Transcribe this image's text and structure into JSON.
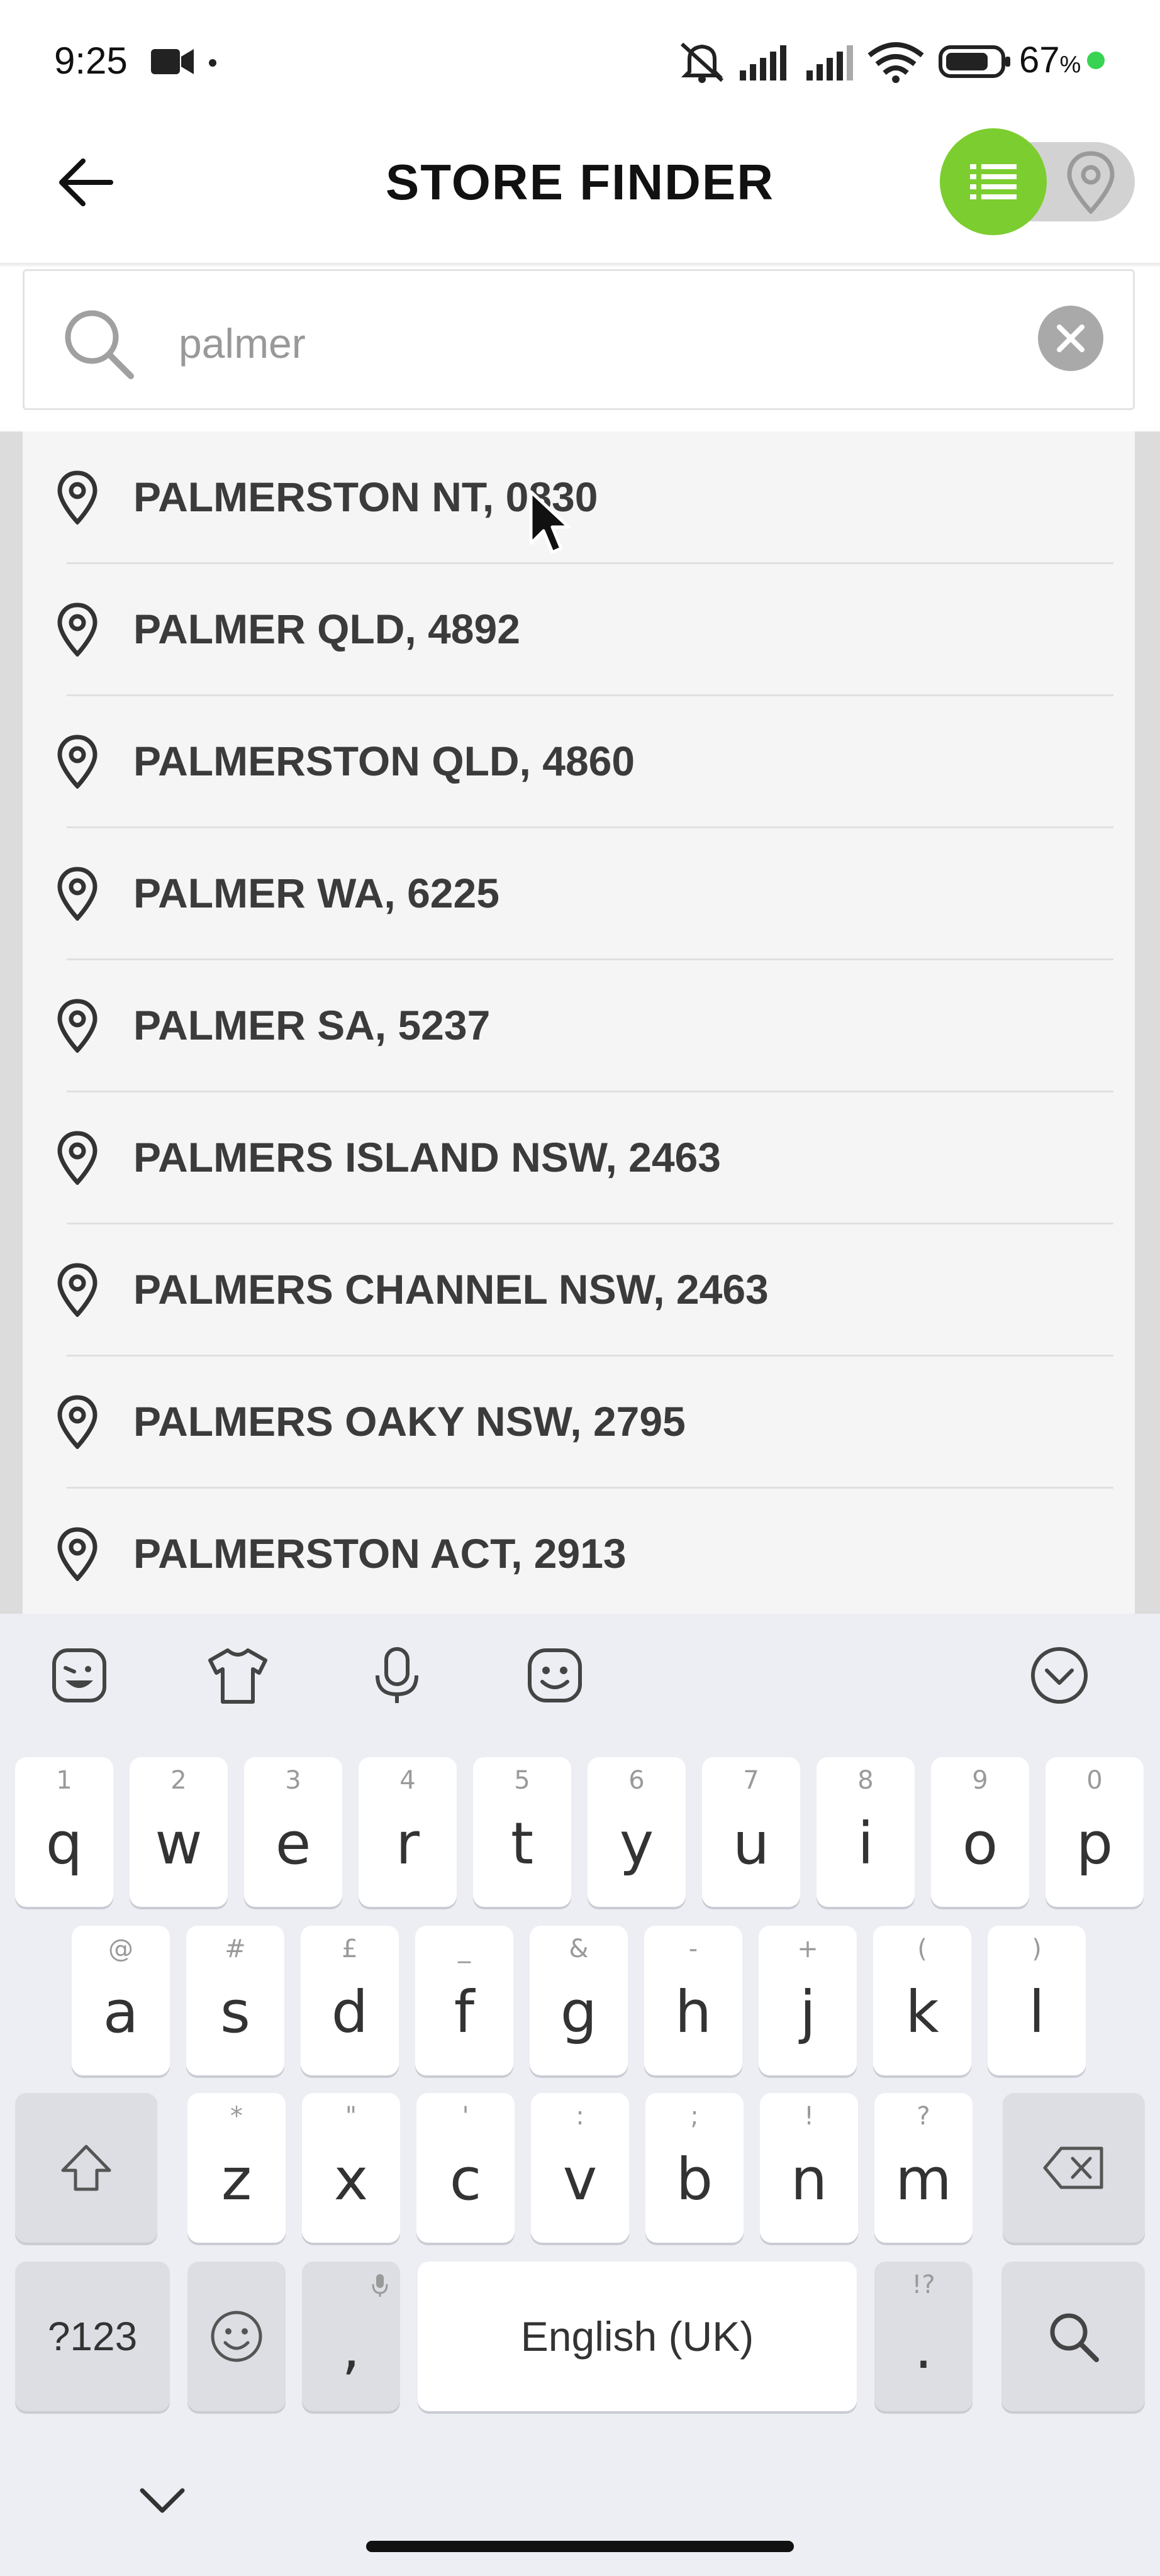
{
  "status_bar": {
    "time": "9:25",
    "battery": "67",
    "battery_unit": "%"
  },
  "header": {
    "title": "STORE FINDER"
  },
  "search": {
    "query": "palmer",
    "placeholder": ""
  },
  "results": [
    {
      "label": "PALMERSTON NT, 0830"
    },
    {
      "label": "PALMER QLD, 4892"
    },
    {
      "label": "PALMERSTON QLD, 4860"
    },
    {
      "label": "PALMER WA, 6225"
    },
    {
      "label": "PALMER SA, 5237"
    },
    {
      "label": "PALMERS ISLAND NSW, 2463"
    },
    {
      "label": "PALMERS CHANNEL NSW, 2463"
    },
    {
      "label": "PALMERS OAKY NSW, 2795"
    },
    {
      "label": "PALMERSTON ACT, 2913"
    }
  ],
  "keyboard": {
    "row1": [
      {
        "key": "q",
        "hint": "1"
      },
      {
        "key": "w",
        "hint": "2"
      },
      {
        "key": "e",
        "hint": "3"
      },
      {
        "key": "r",
        "hint": "4"
      },
      {
        "key": "t",
        "hint": "5"
      },
      {
        "key": "y",
        "hint": "6"
      },
      {
        "key": "u",
        "hint": "7"
      },
      {
        "key": "i",
        "hint": "8"
      },
      {
        "key": "o",
        "hint": "9"
      },
      {
        "key": "p",
        "hint": "0"
      }
    ],
    "row2": [
      {
        "key": "a",
        "hint": "@"
      },
      {
        "key": "s",
        "hint": "#"
      },
      {
        "key": "d",
        "hint": "£"
      },
      {
        "key": "f",
        "hint": "_"
      },
      {
        "key": "g",
        "hint": "&"
      },
      {
        "key": "h",
        "hint": "-"
      },
      {
        "key": "j",
        "hint": "+"
      },
      {
        "key": "k",
        "hint": "("
      },
      {
        "key": "l",
        "hint": ")"
      }
    ],
    "row3": [
      {
        "key": "z",
        "hint": "*"
      },
      {
        "key": "x",
        "hint": "\""
      },
      {
        "key": "c",
        "hint": "'"
      },
      {
        "key": "v",
        "hint": ":"
      },
      {
        "key": "b",
        "hint": ";"
      },
      {
        "key": "n",
        "hint": "!"
      },
      {
        "key": "m",
        "hint": "?"
      }
    ],
    "symbols_label": "?123",
    "comma": ",",
    "space_label": "English (UK)",
    "period": ".",
    "period_hint": "!?"
  },
  "colors": {
    "accent": "#7ccd2f",
    "charge_indicator": "#39d353"
  },
  "icons": [
    "camera-icon",
    "mute-icon",
    "signal-icon",
    "wifi-icon",
    "battery-icon",
    "back-arrow-icon",
    "list-icon",
    "map-pin-icon",
    "search-icon",
    "close-icon",
    "location-pin-icon",
    "cursor-icon",
    "sticker-icon",
    "shirt-icon",
    "mic-icon",
    "emoji-icon",
    "chevron-down-icon",
    "shift-icon",
    "backspace-icon"
  ]
}
